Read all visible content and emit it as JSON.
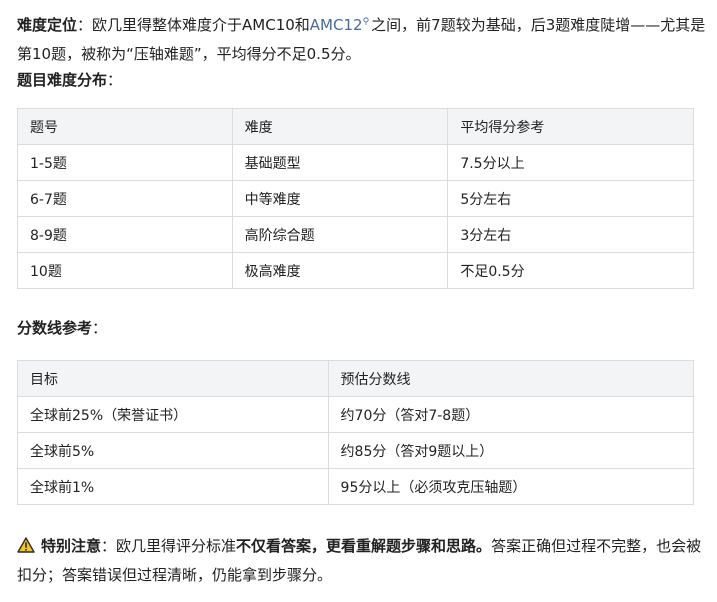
{
  "intro": {
    "label": "难度定位",
    "sep": "：",
    "text1": "欧几里得整体难度介于AMC10和",
    "link": "AMC12",
    "text2": "之间，前7题较为基础，后3题难度陡增——尤其是第10题，被称为“压轴难题”，平均得分不足0.5分。"
  },
  "dist_heading": {
    "label": "题目难度分布",
    "sep": "："
  },
  "difficulty_table": {
    "headers": [
      "题号",
      "难度",
      "平均得分参考"
    ],
    "rows": [
      [
        "1-5题",
        "基础题型",
        "7.5分以上"
      ],
      [
        "6-7题",
        "中等难度",
        "5分左右"
      ],
      [
        "8-9题",
        "高阶综合题",
        "3分左右"
      ],
      [
        "10题",
        "极高难度",
        "不足0.5分"
      ]
    ]
  },
  "score_heading": {
    "label": "分数线参考",
    "sep": "："
  },
  "score_table": {
    "headers": [
      "目标",
      "预估分数线"
    ],
    "rows": [
      [
        "全球前25%（荣誉证书）",
        "约70分（答对7-8题）"
      ],
      [
        "全球前5%",
        "约85分（答对9题以上）"
      ],
      [
        "全球前1%",
        "95分以上（必须攻克压轴题）"
      ]
    ]
  },
  "note": {
    "label": "特别注意",
    "sep": "：",
    "text1": "欧几里得评分标准",
    "bold1": "不仅看答案，更看重解题步骤和思路。",
    "text2": "答案正确但过程不完整，也会被扣分；答案错误但过程清晰，仍能拿到步骤分。"
  },
  "colors": {
    "header_bg": "#f3f4f5",
    "border": "#dcdcdc",
    "link": "#4a6a9c",
    "warn": "#f5c518"
  },
  "icons": {
    "warning": "warning-icon",
    "link_search": "search-icon"
  }
}
